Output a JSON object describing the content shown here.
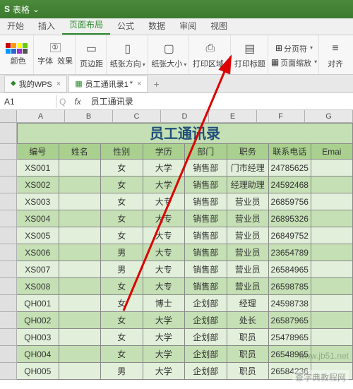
{
  "titlebar": {
    "logo_s": "S",
    "app_name": "表格",
    "dropdown": "⌄"
  },
  "ribbon_tabs": [
    "开始",
    "插入",
    "页面布局",
    "公式",
    "数据",
    "审阅",
    "视图"
  ],
  "ribbon_active_index": 2,
  "ribbon_groups": {
    "color_label": "颜色",
    "font_label": "字体",
    "effect_label": "效果",
    "margin": "页边距",
    "orient": "纸张方向",
    "size": "纸张大小",
    "print_area": "打印区域",
    "print_title": "打印标题",
    "pagebreak": "分页符",
    "scale": "页面缩放",
    "align": "对齐"
  },
  "file_tabs": {
    "wps": "我的WPS",
    "doc": "员工通讯录1",
    "close": "×",
    "plus": "+"
  },
  "namebox": "A1",
  "fx_symbol": "fx",
  "formula_value": "员工通讯录",
  "col_letters": [
    "A",
    "B",
    "C",
    "D",
    "E",
    "F",
    "G"
  ],
  "sheet_title": "员工通讯录",
  "headers": [
    "编号",
    "姓名",
    "性别",
    "学历",
    "部门",
    "职务",
    "联系电话",
    "Emai"
  ],
  "rows": [
    {
      "id": "XS001",
      "sex": "女",
      "edu": "大学",
      "dept": "销售部",
      "role": "门市经理",
      "tel": "24785625"
    },
    {
      "id": "XS002",
      "sex": "女",
      "edu": "大学",
      "dept": "销售部",
      "role": "经理助理",
      "tel": "24592468"
    },
    {
      "id": "XS003",
      "sex": "女",
      "edu": "大专",
      "dept": "销售部",
      "role": "营业员",
      "tel": "26859756"
    },
    {
      "id": "XS004",
      "sex": "女",
      "edu": "大专",
      "dept": "销售部",
      "role": "营业员",
      "tel": "26895326"
    },
    {
      "id": "XS005",
      "sex": "女",
      "edu": "大专",
      "dept": "销售部",
      "role": "营业员",
      "tel": "26849752"
    },
    {
      "id": "XS006",
      "sex": "男",
      "edu": "大专",
      "dept": "销售部",
      "role": "营业员",
      "tel": "23654789"
    },
    {
      "id": "XS007",
      "sex": "男",
      "edu": "大专",
      "dept": "销售部",
      "role": "营业员",
      "tel": "26584965"
    },
    {
      "id": "XS008",
      "sex": "女",
      "edu": "大专",
      "dept": "销售部",
      "role": "营业员",
      "tel": "26598785"
    },
    {
      "id": "QH001",
      "sex": "女",
      "edu": "博士",
      "dept": "企划部",
      "role": "经理",
      "tel": "24598738"
    },
    {
      "id": "QH002",
      "sex": "女",
      "edu": "大学",
      "dept": "企划部",
      "role": "处长",
      "tel": "26587965"
    },
    {
      "id": "QH003",
      "sex": "女",
      "edu": "大学",
      "dept": "企划部",
      "role": "职员",
      "tel": "25478965"
    },
    {
      "id": "QH004",
      "sex": "女",
      "edu": "大学",
      "dept": "企划部",
      "role": "职员",
      "tel": "26548965"
    },
    {
      "id": "QH005",
      "sex": "男",
      "edu": "大学",
      "dept": "企划部",
      "role": "职员",
      "tel": "26584236"
    }
  ],
  "watermark1": "www.jb51.net",
  "watermark2": "查字典教程网"
}
